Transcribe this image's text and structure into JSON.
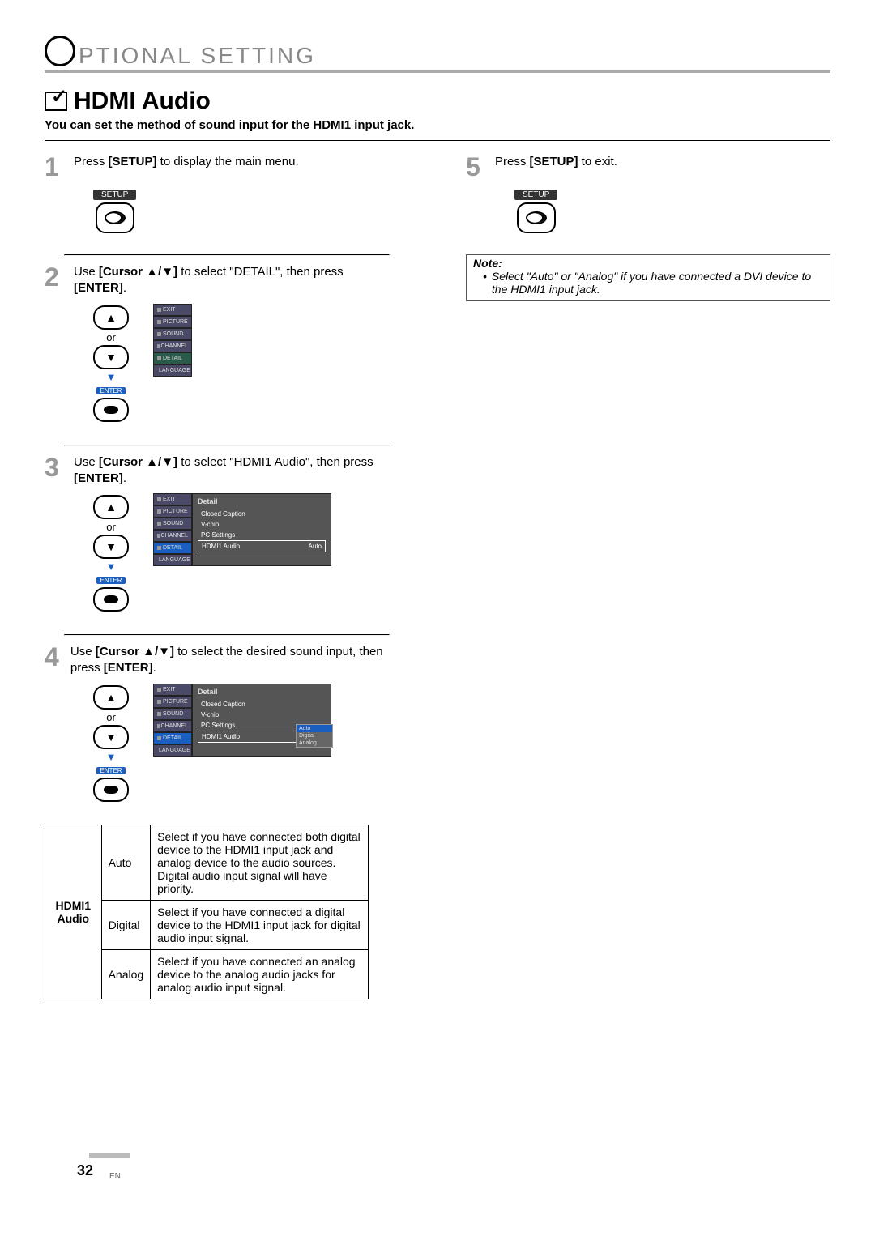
{
  "header_text": "PTIONAL   SETTING",
  "section_title": "HDMI Audio",
  "subtitle": "You can set the method of sound input for the HDMI1 input jack.",
  "setup_label": "SETUP",
  "or": "or",
  "enter": "ENTER",
  "steps": {
    "s1_num": "1",
    "s1_text_a": "Press ",
    "s1_text_b": "[SETUP]",
    "s1_text_c": " to display the main menu.",
    "s2_num": "2",
    "s2_text_a": "Use ",
    "s2_text_b": "[Cursor ▲/▼]",
    "s2_text_c": " to select \"DETAIL\", then press",
    "s2_text_d": "[ENTER]",
    "s3_num": "3",
    "s3_text_a": "Use ",
    "s3_text_b": "[Cursor ▲/▼]",
    "s3_text_c": " to select \"HDMI1 Audio\", then press",
    "s3_text_d": "[ENTER]",
    "s4_num": "4",
    "s4_text_a": "Use ",
    "s4_text_b": "[Cursor ▲/▼]",
    "s4_text_c": " to select the desired sound input, then press ",
    "s4_text_d": "[ENTER]",
    "s5_num": "5",
    "s5_text_a": "Press ",
    "s5_text_b": "[SETUP]",
    "s5_text_c": " to exit."
  },
  "osd_menu": [
    "EXIT",
    "PICTURE",
    "SOUND",
    "CHANNEL",
    "DETAIL",
    "LANGUAGE"
  ],
  "osd_panel_title": "Detail",
  "osd_panel_items": [
    "Closed Caption",
    "V-chip",
    "PC Settings",
    "HDMI1 Audio"
  ],
  "osd_value_auto": "Auto",
  "osd_dropdown": [
    "Auto",
    "Digital",
    "Analog"
  ],
  "table": {
    "header": "HDMI1 Audio",
    "rows": [
      {
        "opt": "Auto",
        "desc": "Select if you have connected both digital device to the HDMI1 input jack and analog device to the audio sources. Digital audio input signal will have priority."
      },
      {
        "opt": "Digital",
        "desc": "Select if you have connected a digital device to the HDMI1 input jack for digital audio input signal."
      },
      {
        "opt": "Analog",
        "desc": "Select if you have connected an analog device to the analog audio jacks for analog audio input signal."
      }
    ]
  },
  "note_title": "Note:",
  "note_text": "Select \"Auto\" or \"Analog\" if you have connected a DVI device to the HDMI1 input jack.",
  "page_num": "32",
  "page_reg": "EN"
}
